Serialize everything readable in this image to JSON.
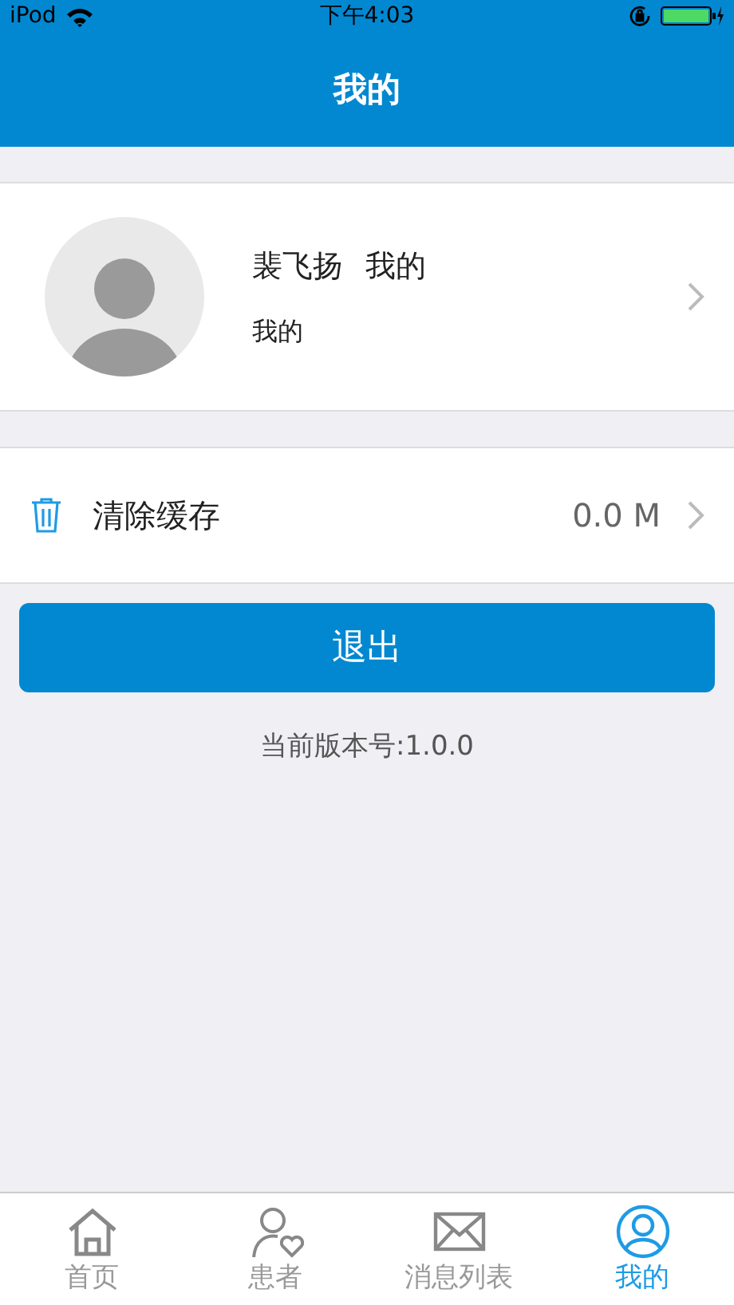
{
  "status_bar": {
    "carrier": "iPod",
    "time": "下午4:03"
  },
  "nav": {
    "title": "我的"
  },
  "profile": {
    "name": "裴飞扬",
    "role": "我的",
    "subtitle": "我的"
  },
  "settings": [
    {
      "kind": "trash",
      "label": "清除缓存",
      "value": "0.0 M"
    }
  ],
  "logout_button": "退出",
  "version": "当前版本号:1.0.0",
  "tabs": [
    {
      "kind": "home",
      "label": "首页",
      "selected": false
    },
    {
      "kind": "patient",
      "label": "患者",
      "selected": false
    },
    {
      "kind": "mail",
      "label": "消息列表",
      "selected": false
    },
    {
      "kind": "me",
      "label": "我的",
      "selected": true
    }
  ]
}
